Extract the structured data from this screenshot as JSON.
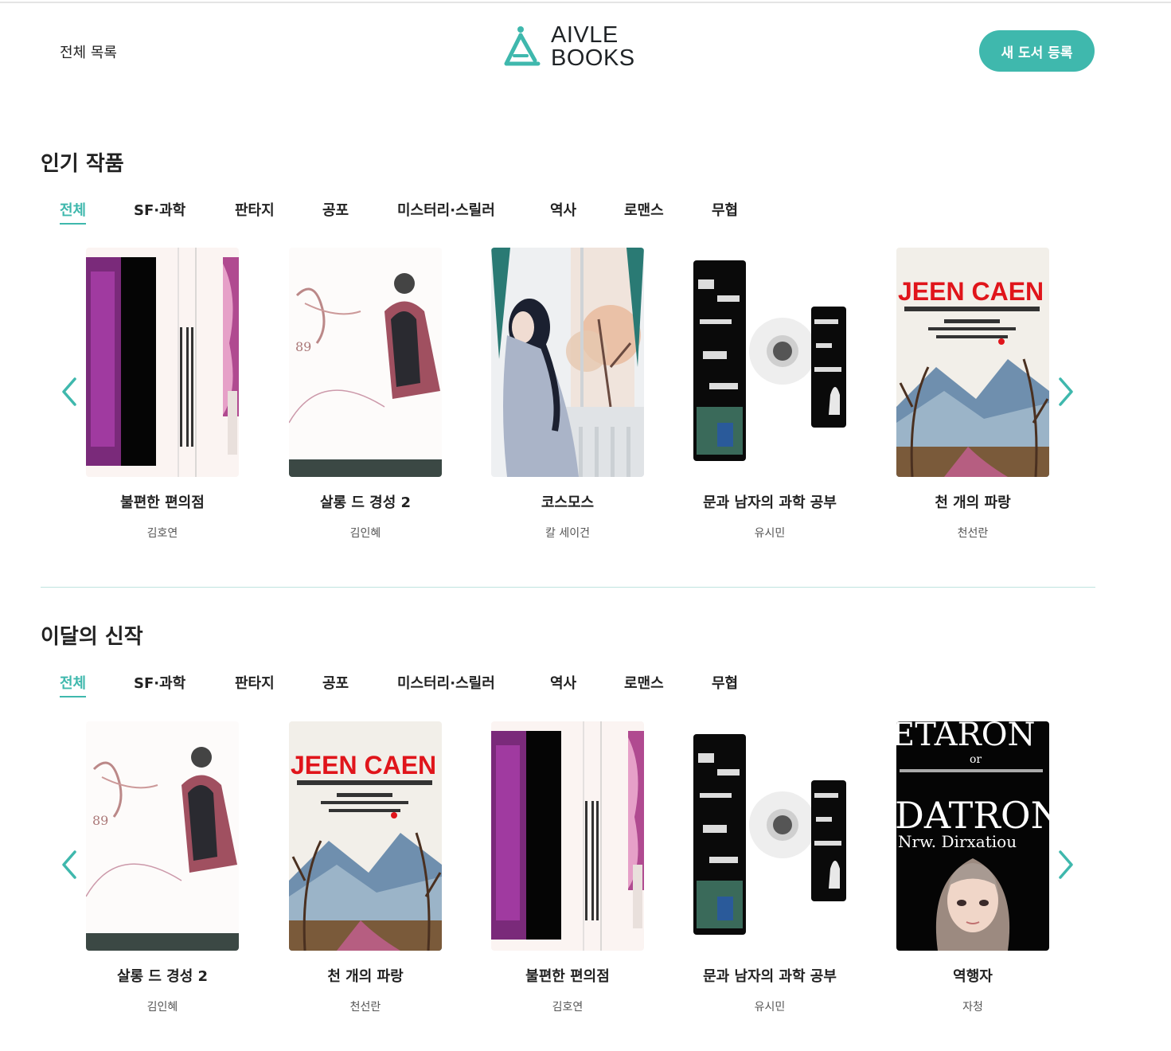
{
  "header": {
    "nav_all": "전체 목록",
    "logo_line1": "AIVLE",
    "logo_line2": "BOOKS",
    "new_book_button": "새 도서 등록"
  },
  "colors": {
    "accent": "#3fb8ad",
    "divider": "#bfe3df"
  },
  "popular": {
    "title": "인기 작품",
    "tabs": [
      "전체",
      "SF·과학",
      "판타지",
      "공포",
      "미스터리·스릴러",
      "역사",
      "로맨스",
      "무협"
    ],
    "active_tab": "전체",
    "books": [
      {
        "title": "불편한 편의점",
        "author": "김호연",
        "cover": "magenta-panel"
      },
      {
        "title": "살롱 드 경성 2",
        "author": "김인혜",
        "cover": "sketch-figure"
      },
      {
        "title": "코스모스",
        "author": "칼 세이건",
        "cover": "woman-window"
      },
      {
        "title": "문과 남자의 과학 공부",
        "author": "유시민",
        "cover": "collage-dark"
      },
      {
        "title": "천 개의 파랑",
        "author": "천선란",
        "cover": "jeen-caen"
      }
    ]
  },
  "new_releases": {
    "title": "이달의 신작",
    "tabs": [
      "전체",
      "SF·과학",
      "판타지",
      "공포",
      "미스터리·스릴러",
      "역사",
      "로맨스",
      "무협"
    ],
    "active_tab": "전체",
    "books": [
      {
        "title": "살롱 드 경성 2",
        "author": "김인혜",
        "cover": "sketch-figure"
      },
      {
        "title": "천 개의 파랑",
        "author": "천선란",
        "cover": "jeen-caen"
      },
      {
        "title": "불편한 편의점",
        "author": "김호연",
        "cover": "magenta-panel"
      },
      {
        "title": "문과 남자의 과학 공부",
        "author": "유시민",
        "cover": "collage-dark"
      },
      {
        "title": "역행자",
        "author": "자청",
        "cover": "datron"
      }
    ]
  },
  "cover_text": {
    "jeen_caen": "JEEN CAEN",
    "datron_top": "ETARON",
    "datron_or": "or",
    "datron_main": "DATRON",
    "datron_sub": "Nrw. Dirxatiou"
  }
}
